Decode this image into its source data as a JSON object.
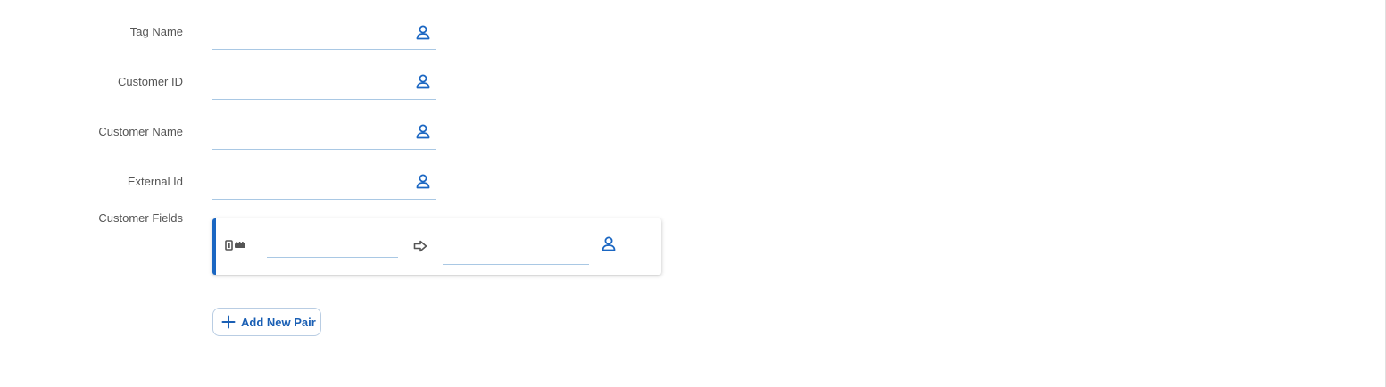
{
  "form": {
    "tag_name": {
      "label": "Tag Name",
      "value": "",
      "icon": "user-icon"
    },
    "customer_id": {
      "label": "Customer ID",
      "value": "",
      "icon": "user-icon"
    },
    "customer_name": {
      "label": "Customer Name",
      "value": "",
      "icon": "user-icon"
    },
    "external_id": {
      "label": "External Id",
      "value": "",
      "icon": "user-icon"
    },
    "customer_fields": {
      "label": "Customer Fields",
      "pairs": [
        {
          "key": "",
          "value": "",
          "key_icon": "key-value-icon",
          "arrow_icon": "arrow-right-icon",
          "value_icon": "user-icon"
        }
      ]
    }
  },
  "actions": {
    "add_pair_label": "Add New Pair",
    "add_pair_icon": "plus-icon"
  },
  "colors": {
    "accent": "#1a66c2",
    "underline": "#a9c8e4",
    "label": "#555555"
  }
}
